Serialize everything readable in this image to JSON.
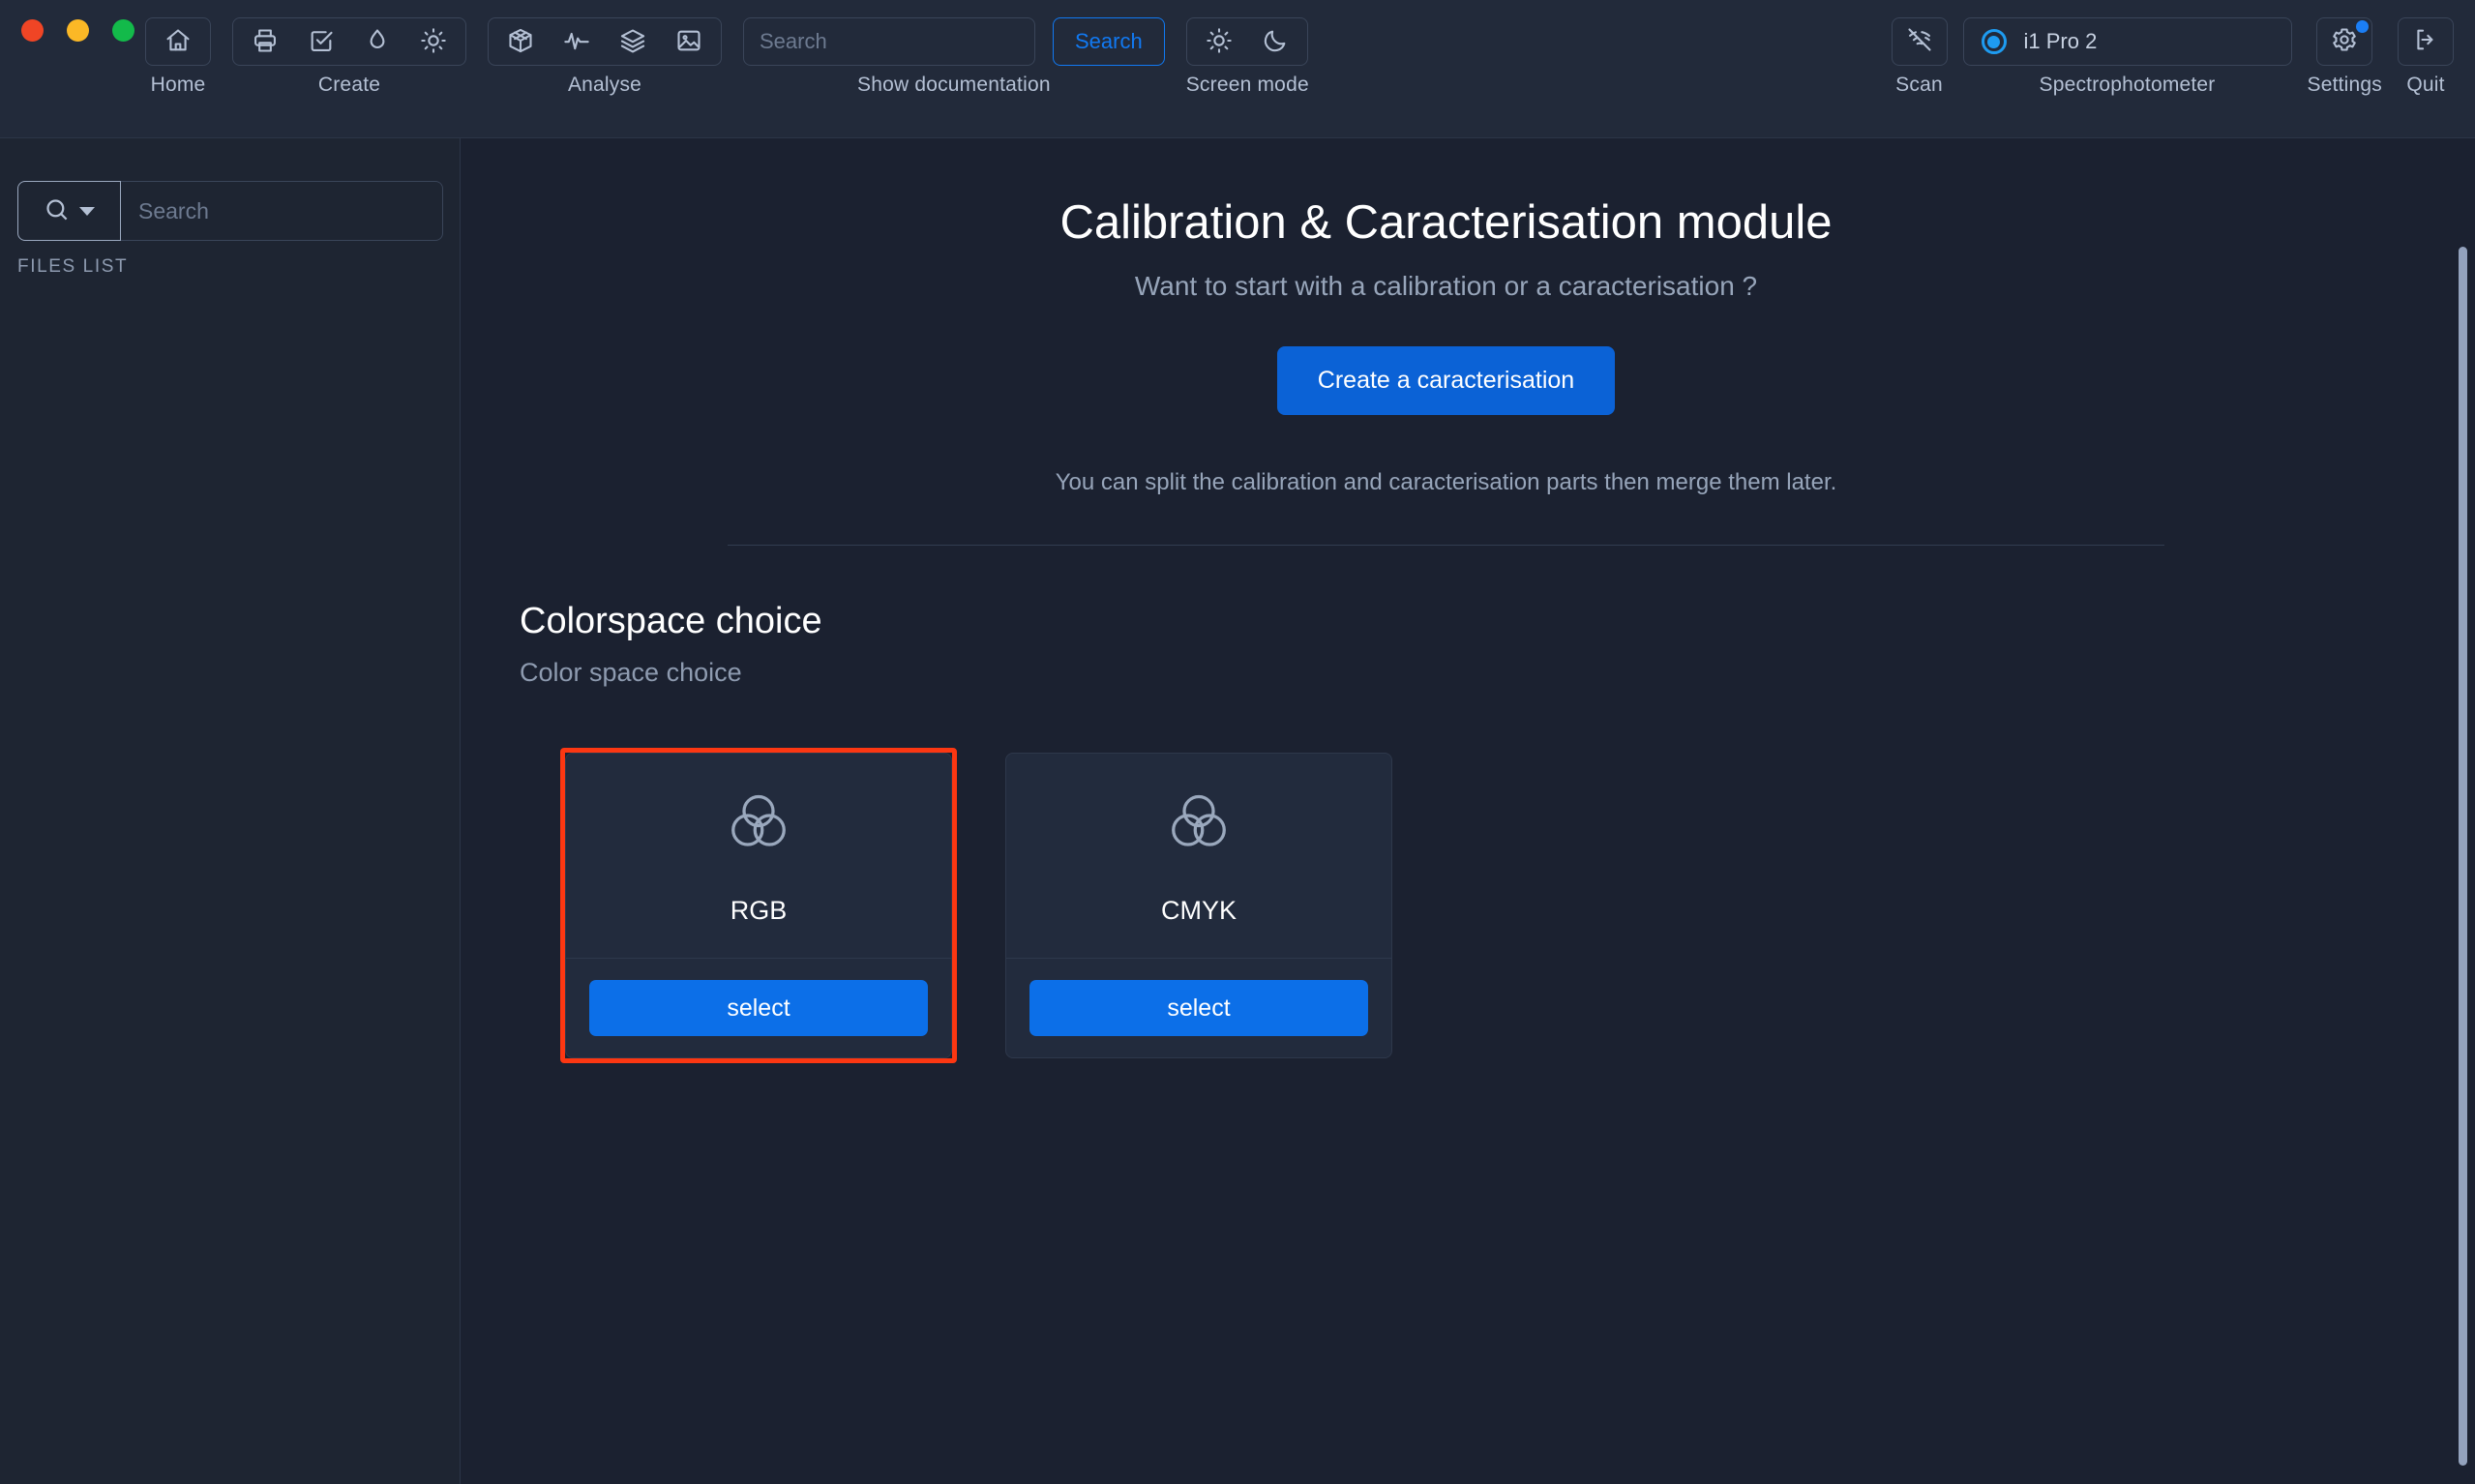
{
  "toolbar": {
    "window_controls": [
      "close",
      "minimize",
      "maximize"
    ],
    "groups": [
      {
        "label": "Home",
        "icons": [
          "home-icon"
        ]
      },
      {
        "label": "Create",
        "icons": [
          "printer-icon",
          "checkbox-task-icon",
          "droplet-icon",
          "sun-icon"
        ]
      },
      {
        "label": "Analyse",
        "icons": [
          "cube-3d-icon",
          "pulse-activity-icon",
          "layers-icon",
          "image-icon"
        ]
      }
    ],
    "documentation": {
      "label": "Show documentation",
      "input_placeholder": "Search",
      "input_value": "",
      "search_button": "Search"
    },
    "screen_mode": {
      "label": "Screen mode",
      "icons": [
        "sun-icon",
        "moon-icon"
      ]
    },
    "scan": {
      "label": "Scan",
      "icon": "wifi-off-icon"
    },
    "spectrophotometer": {
      "label": "Spectrophotometer",
      "device": "i1 Pro 2",
      "status": "connected"
    },
    "settings": {
      "label": "Settings",
      "icon": "gear-icon",
      "badge": true
    },
    "quit": {
      "label": "Quit",
      "icon": "logout-icon"
    }
  },
  "sidebar": {
    "search": {
      "placeholder": "Search",
      "value": "",
      "icon": "search-icon",
      "dropdown_icon": "chevron-down-icon"
    },
    "files_list_label": "FILES LIST",
    "files": []
  },
  "main": {
    "title": "Calibration & Caracterisation module",
    "subtitle": "Want to start with a calibration or a caracterisation ?",
    "primary_button": "Create a caracterisation",
    "note": "You can split the calibration and caracterisation parts then merge them later.",
    "section": {
      "title": "Colorspace choice",
      "subtitle": "Color space choice"
    },
    "cards": [
      {
        "name": "RGB",
        "icon": "venn-three-circles-icon",
        "button": "select",
        "highlighted": true
      },
      {
        "name": "CMYK",
        "icon": "venn-three-circles-icon",
        "button": "select",
        "highlighted": false
      }
    ]
  },
  "colors": {
    "accent_blue": "#0c6fe8",
    "link_blue": "#1179f2",
    "highlight_red": "#fc3712",
    "topbar_bg": "#222a3a",
    "sidebar_bg": "#1e2532",
    "main_bg": "#1b2130",
    "card_bg": "#222b3d",
    "text_primary": "#ffffff",
    "text_muted": "#97a5ba"
  }
}
